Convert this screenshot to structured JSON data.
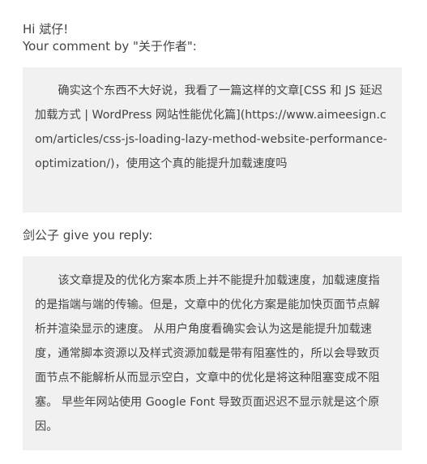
{
  "greeting": {
    "hello_line": "Hi 斌仔!",
    "comment_line": "Your comment by \"关于作者\":"
  },
  "comment": {
    "text": "确实这个东西不大好说，我看了一篇这样的文章[CSS 和 JS 延迟加载方式 | WordPress 网站性能优化篇](https://www.aimeesign.com/articles/css-js-loading-lazy-method-website-performance-optimization/)，使用这个真的能提升加载速度吗"
  },
  "reply": {
    "header": "剑公子 give you reply:",
    "text": "该文章提及的优化方案本质上并不能提升加载速度，加载速度指的是指端与端的传输。但是，文章中的优化方案是能加快页面节点解析并渲染显示的速度。 从用户角度看确实会认为这是能提升加载速度，通常脚本资源以及样式资源加载是带有阻塞性的，所以会导致页面节点不能解析从而显示空白，文章中的优化是将这种阻塞变成不阻塞。 早些年网站使用 Google Font 导致页面迟迟不显示就是这个原因。"
  }
}
